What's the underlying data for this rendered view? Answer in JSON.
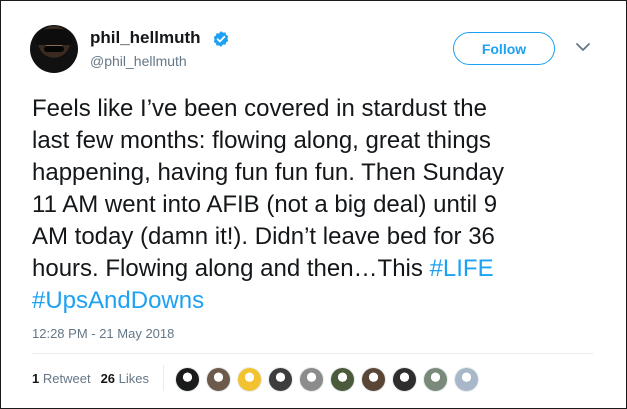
{
  "author": {
    "display_name": "phil_hellmuth",
    "handle": "@phil_hellmuth",
    "verified": true,
    "verified_icon": "verified-badge-icon"
  },
  "actions": {
    "follow_label": "Follow",
    "menu_icon": "chevron-down-icon"
  },
  "tweet": {
    "text_main": "Feels like I’ve been covered in stardust the\nlast few months: flowing along, great things\nhappening, having fun fun fun. Then Sunday\n11 AM went into AFIB (not a big deal) until 9\nAM today (damn it!). Didn’t leave bed for 36\nhours.  Flowing along and then…This ",
    "hashtag_1": "#LIFE",
    "hashtag_2": "#UpsAndDowns",
    "timestamp": "12:28 PM - 21 May 2018"
  },
  "stats": {
    "retweets_count": "1",
    "retweets_label": "Retweet",
    "likes_count": "26",
    "likes_label": "Likes"
  },
  "likers": [
    {
      "color": "#1b1b1b"
    },
    {
      "color": "#6d5a4a"
    },
    {
      "color": "#f2c230"
    },
    {
      "color": "#3d3d3d"
    },
    {
      "color": "#8c8c8c"
    },
    {
      "color": "#4a5a3a"
    },
    {
      "color": "#5a4636"
    },
    {
      "color": "#2e2e2e"
    },
    {
      "color": "#7a8a7a"
    },
    {
      "color": "#a8b8c8"
    }
  ],
  "colors": {
    "accent": "#1da1f2",
    "text": "#14171a",
    "muted": "#657786"
  }
}
